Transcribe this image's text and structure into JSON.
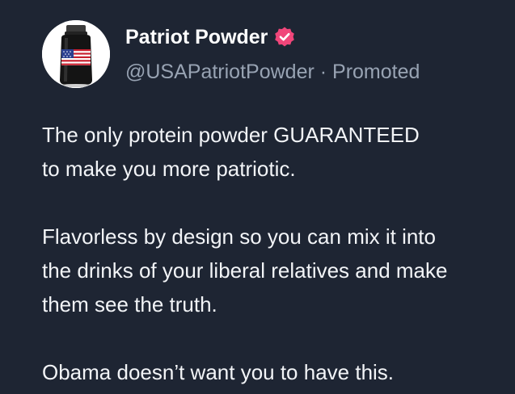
{
  "author": {
    "display_name": "Patriot Powder",
    "handle": "@USAPatriotPowder",
    "separator": " · ",
    "promoted_label": "Promoted",
    "verified_color": "#f0467a",
    "avatar_icon": "protein-tub-flag-icon"
  },
  "post": {
    "paragraphs": [
      "The only protein powder GUARANTEED\nto make you more patriotic.",
      "Flavorless by design so you can mix it into\nthe drinks of your liberal relatives and make\nthem see the truth.",
      "Obama doesn’t want you to have this."
    ]
  },
  "theme": {
    "background": "#1e2533",
    "text": "#f2f4f7",
    "muted": "#98a3b3"
  }
}
